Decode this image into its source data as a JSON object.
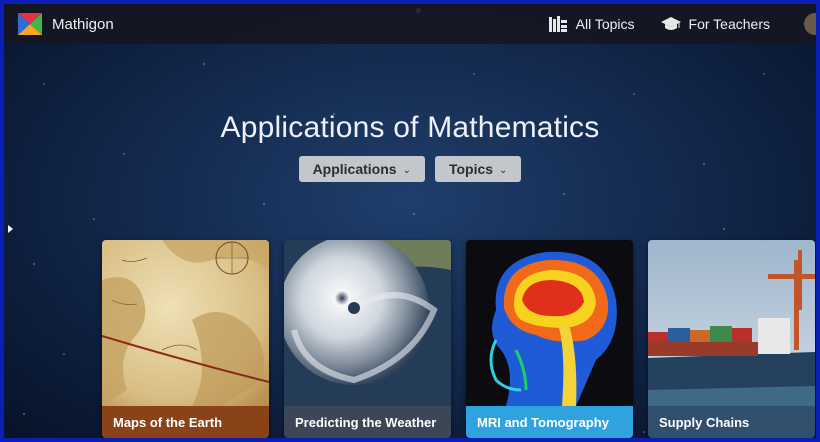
{
  "header": {
    "brand": "Mathigon",
    "nav": [
      {
        "label": "All Topics",
        "icon": "books-icon"
      },
      {
        "label": "For Teachers",
        "icon": "graduation-cap-icon"
      }
    ]
  },
  "hero": {
    "title": "Applications of Mathematics",
    "filters": [
      {
        "label": "Applications",
        "chevron": "⌄"
      },
      {
        "label": "Topics",
        "chevron": "⌄"
      }
    ]
  },
  "cards": [
    {
      "title": "Maps of the Earth",
      "color": "#8a4319"
    },
    {
      "title": "Predicting the Weather",
      "color": "#3c4656"
    },
    {
      "title": "MRI and Tomography",
      "color": "#2fa3df"
    },
    {
      "title": "Supply Chains",
      "color": "#30506e"
    }
  ],
  "colors": {
    "topbar": "#161622",
    "background": "#152c52",
    "dropdown": "#c3c7cc"
  }
}
